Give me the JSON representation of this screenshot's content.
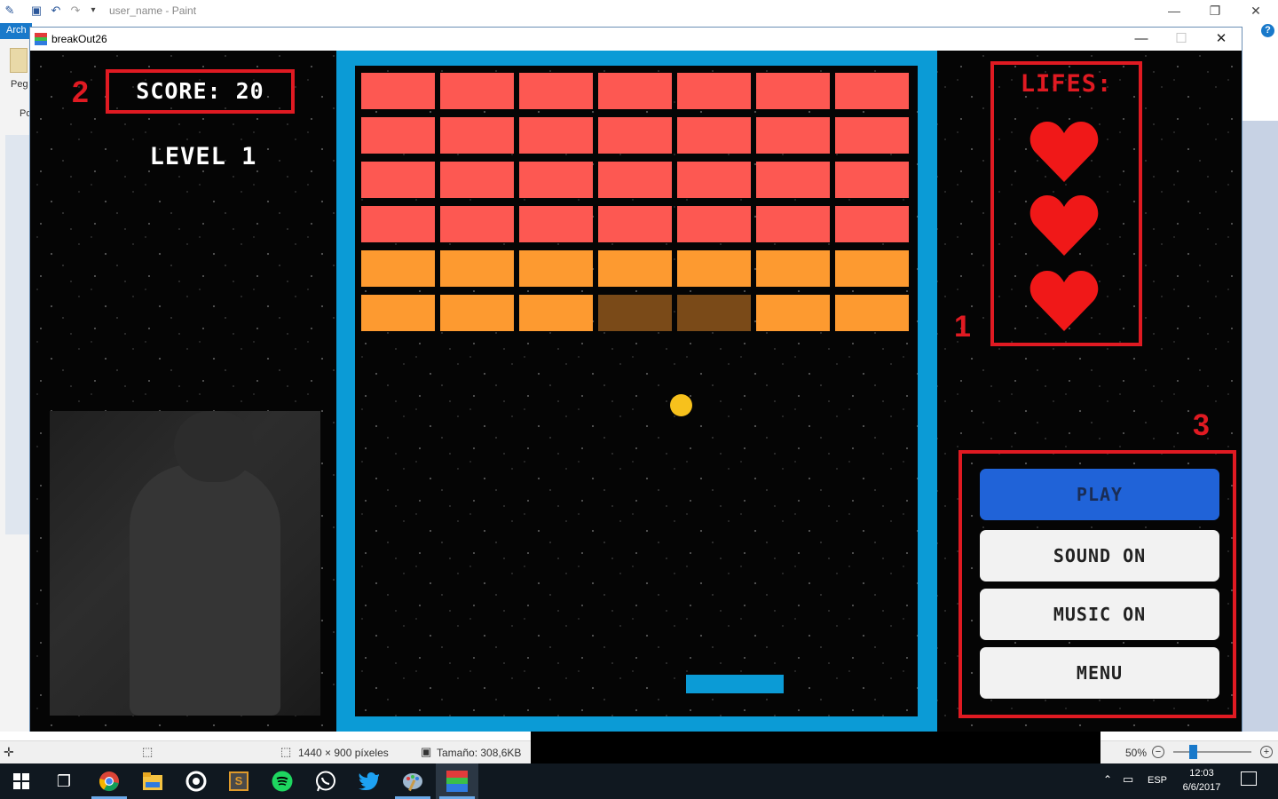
{
  "paint": {
    "title": "user_name - Paint",
    "ribbon_tab": "Arch",
    "left_label_1": "Peg",
    "left_label_2": "Po",
    "status_dimensions": "1440 × 900 píxeles",
    "status_size": "Tamaño: 308,6KB",
    "zoom": "50%",
    "help": "?"
  },
  "game_window": {
    "title": "breakOut26",
    "minimize": "—",
    "maximize": "☐",
    "close": "✕"
  },
  "hud": {
    "score_label": "SCORE: 20",
    "level_label": "LEVEL 1",
    "lives_label": "LIFES:",
    "lives_count": 3
  },
  "annotations": [
    "1",
    "2",
    "3"
  ],
  "buttons": {
    "play": "PLAY",
    "sound": "SOUND ON",
    "music": "MUSIC ON",
    "menu": "MENU"
  },
  "bricks": {
    "columns": 7,
    "colors": {
      "red": "#fd5852",
      "orange": "#fd9a30",
      "damaged": "#7a4a18"
    },
    "rows": [
      [
        "red",
        "red",
        "red",
        "red",
        "red",
        "red",
        "red"
      ],
      [
        "red",
        "red",
        "red",
        "red",
        "red",
        "red",
        "red"
      ],
      [
        "red",
        "red",
        "red",
        "red",
        "red",
        "red",
        "red"
      ],
      [
        "red",
        "red",
        "red",
        "red",
        "red",
        "red",
        "red"
      ],
      [
        "orange",
        "orange",
        "orange",
        "orange",
        "orange",
        "orange",
        "orange"
      ],
      [
        "orange",
        "orange",
        "orange",
        "damaged",
        "damaged",
        "orange",
        "orange"
      ]
    ]
  },
  "colors": {
    "playfield_border": "#0b9bd6",
    "ball": "#f7c11c",
    "annotation_red": "#e01a22",
    "play_button": "#2063d8"
  },
  "taskbar": {
    "time": "12:03",
    "date": "6/6/2017",
    "language": "ESP",
    "icons": [
      "windows-start-icon",
      "task-view-icon",
      "chrome-icon",
      "file-explorer-icon",
      "media-icon",
      "sublime-icon",
      "spotify-icon",
      "whatsapp-icon",
      "twitter-icon",
      "paint-icon",
      "breakout-app-icon"
    ]
  }
}
